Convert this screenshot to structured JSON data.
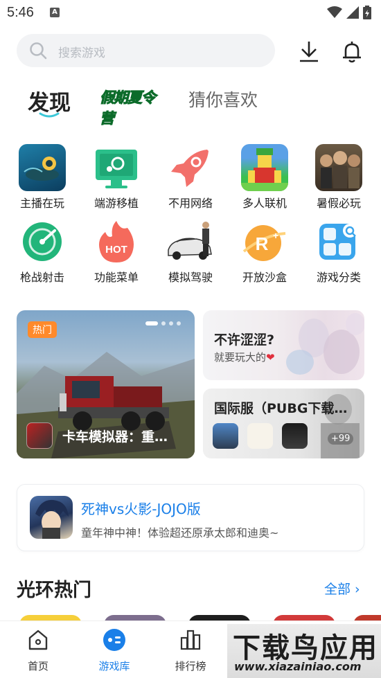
{
  "status_bar": {
    "time": "5:46",
    "notification_letter": "A"
  },
  "search": {
    "placeholder": "搜索游戏"
  },
  "header_icons": {
    "download": "download-icon",
    "bell": "bell-icon"
  },
  "tabs": {
    "discover": "发现",
    "summer_camp": "假期夏令营",
    "guess_you_like": "猜你喜欢"
  },
  "categories": [
    {
      "label": "主播在玩",
      "icon": "subnautica-game-icon"
    },
    {
      "label": "端游移植",
      "icon": "steam-monitor-icon"
    },
    {
      "label": "不用网络",
      "icon": "rocket-icon"
    },
    {
      "label": "多人联机",
      "icon": "roblox-avatar-icon"
    },
    {
      "label": "暑假必玩",
      "icon": "survivors-game-icon"
    },
    {
      "label": "枪战射击",
      "icon": "radar-icon"
    },
    {
      "label": "功能菜单",
      "icon": "hot-fire-icon"
    },
    {
      "label": "模拟驾驶",
      "icon": "car-driver-icon"
    },
    {
      "label": "开放沙盒",
      "icon": "r-planet-icon"
    },
    {
      "label": "游戏分类",
      "icon": "category-grid-icon"
    }
  ],
  "banner": {
    "badge": "热门",
    "title": "卡车模拟器：重…"
  },
  "card_anime": {
    "title": "不许涩涩?",
    "subtitle": "就要玩大的",
    "heart": "❤"
  },
  "card_pubg": {
    "title": "国际服（PUBG下载…",
    "more_count": "+99"
  },
  "promo": {
    "title": "死神vs火影-JOJO版",
    "subtitle": "童年神中神！体验超还原承太郎和迪奥~"
  },
  "section": {
    "title": "光环热门",
    "all_label": "全部 ›"
  },
  "tab_bar": [
    {
      "label": "首页",
      "icon": "home-icon",
      "active": false
    },
    {
      "label": "游戏库",
      "icon": "game-library-icon",
      "active": true
    },
    {
      "label": "排行榜",
      "icon": "ranking-icon",
      "active": false
    }
  ],
  "watermark": {
    "main": "下载鸟应用",
    "url": "www.xiazainiao.com"
  },
  "colors": {
    "accent": "#1a7fe8",
    "hot_badge": "#ff8a2b",
    "search_bg": "#f2f3f5"
  }
}
